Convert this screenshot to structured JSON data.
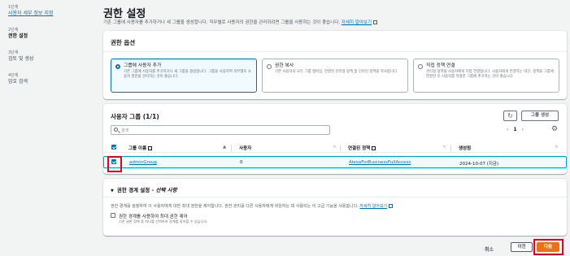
{
  "steps": [
    {
      "num": "1단계",
      "label": "사용자 세부 정보 지정"
    },
    {
      "num": "2단계",
      "label": "권한 설정"
    },
    {
      "num": "3단계",
      "label": "검토 및 생성"
    },
    {
      "num": "4단계",
      "label": "암호 검색"
    }
  ],
  "page": {
    "title": "권한 설정",
    "desc": "기존 그룹에 사용자를 추가하거나 새 그룹을 생성합니다. 직무별로 사용자의 권한을 관리하려면 그룹을 사용하는 것이 좋습니다.",
    "learn_more": "자세히 알아보기"
  },
  "options": {
    "title": "권한 옵션",
    "tiles": [
      {
        "title": "그룹에 사용자 추가",
        "desc": "기존 그룹에 사용자를 추가하거나 새 그룹을 생성합니다. 그룹을 사용하여 직무별로 사용자 권한을 관리하는 것이 좋습니다.",
        "selected": true
      },
      {
        "title": "권한 복사",
        "desc": "기존 사용자의 모든 그룹 멤버십, 연결된 관리형 정책 및 인라인 정책을 복사합니다.",
        "selected": false
      },
      {
        "title": "직접 정책 연결",
        "desc": "관리형 정책을 사용자에게 직접 연결합니다. 사용자에게 연결하는 대신, 정책을 그룹에 연결한 후 사용자를 적절한 그룹에 추가하는 것이 좋습니다.",
        "selected": false
      }
    ]
  },
  "groups": {
    "title": "사용자 그룹 (1/1)",
    "create_label": "그룹 생성",
    "refresh_icon": "refresh-icon",
    "search_placeholder": "검색",
    "page_number": "1",
    "columns": [
      "그룹 이름",
      "사용자",
      "연결된 정책",
      "생성됨"
    ],
    "rows": [
      {
        "name": "adminGroup",
        "users": "0",
        "policy": "AlexaForBusinessFullAccess",
        "created": "2024-10-07 (지금)",
        "checked": true
      }
    ]
  },
  "boundary": {
    "title": "권한 경계 설정 - ",
    "title_opt": "선택 사항",
    "desc": "권한 경계를 설정하여 이 사용자에게 대한 최대 권한을 제어합니다. 권한 관리를 다른 사용자에게 위임하는 데 사용되는 이 고급 기능을 사용합니다.",
    "learn_more": "자세히 알아보기",
    "check_label": "권한 경계를 사용하여 최대 권한 제어",
    "check_desc": "기존 권한 정책 중 하나를 선택하여 경계를 정의할 수 있습니다."
  },
  "footer": {
    "cancel": "취소",
    "prev": "이전",
    "next": "다음"
  },
  "colors": {
    "accent": "#0073bb",
    "primary": "#ec7211",
    "highlight": "#e8001c"
  }
}
